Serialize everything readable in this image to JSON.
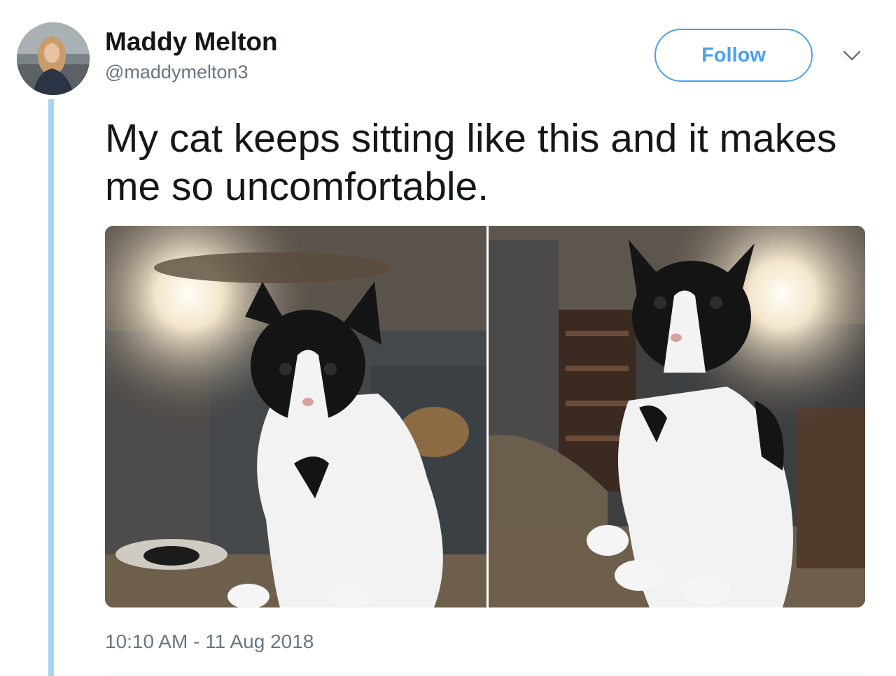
{
  "author": {
    "name": "Maddy Melton",
    "handle": "@maddymelton3",
    "avatar_icon": "profile-photo"
  },
  "actions": {
    "follow_label": "Follow",
    "menu_icon": "chevron-down-icon"
  },
  "tweet": {
    "text": "My cat keeps sitting like this and it makes me so uncomfortable.",
    "timestamp": "10:10 AM - 11 Aug 2018"
  },
  "media": {
    "photo_count": 2
  },
  "colors": {
    "accent": "#4aa1ec",
    "thread_line": "#a8d4f4",
    "secondary_text": "#657786",
    "primary_text": "#14171a"
  }
}
